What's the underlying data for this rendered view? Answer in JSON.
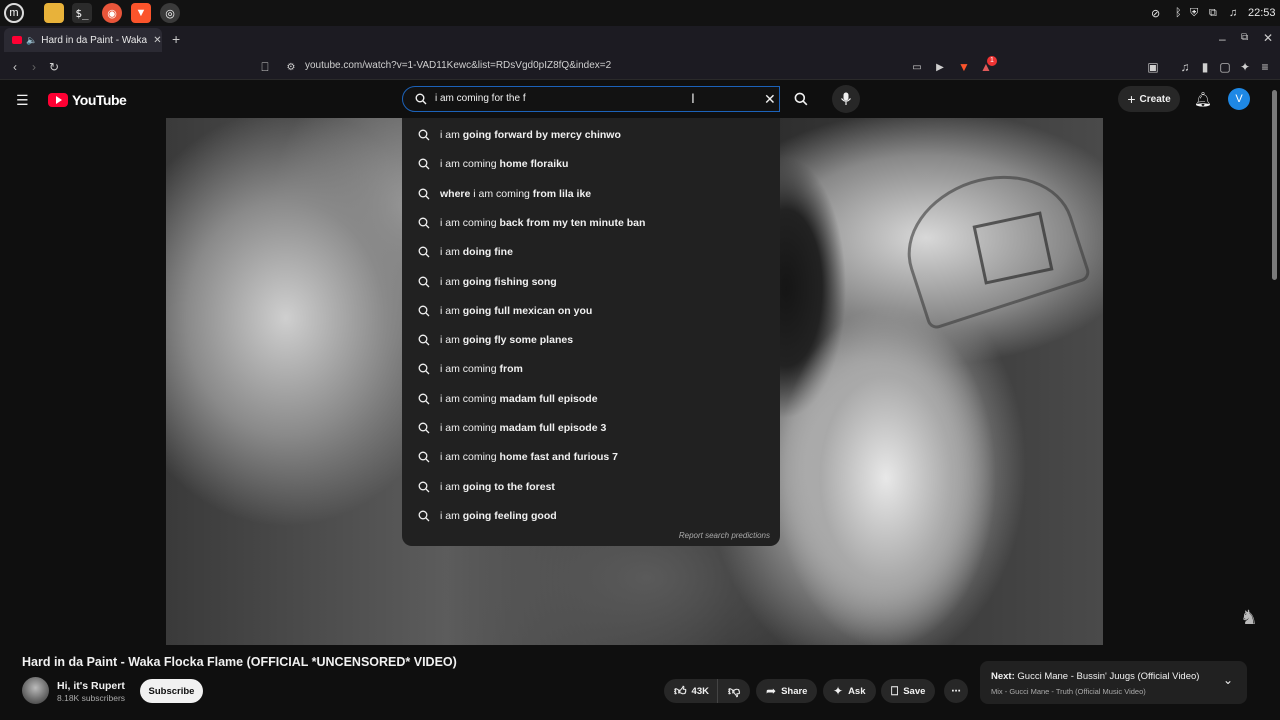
{
  "os": {
    "clock": "22:53",
    "launcher_icons": [
      "mint-menu-icon",
      "files-icon",
      "terminal-icon",
      "firefox-icon",
      "brave-icon",
      "chromium-icon"
    ]
  },
  "browser": {
    "tab_title": "Hard in da Paint - Waka Flo",
    "url": "youtube.com/watch?v=1-VAD11Kewc&list=RDsVgd0pIZ8fQ&index=2",
    "extension_badge": "1"
  },
  "youtube": {
    "logo_text": "YouTube",
    "search": {
      "value": "i am coming for the f",
      "suggestions": [
        {
          "prefix": "i am ",
          "rest": "going forward by mercy chinwo"
        },
        {
          "prefix": "i am coming ",
          "rest": "home floraiku"
        },
        {
          "prefix": "where ",
          "mid": "i am coming ",
          "rest": "from lila ike"
        },
        {
          "prefix": "i am coming ",
          "rest": "back from my ten minute ban"
        },
        {
          "prefix": "i am ",
          "rest": "doing fine"
        },
        {
          "prefix": "i am ",
          "rest": "going fishing song"
        },
        {
          "prefix": "i am ",
          "rest": "going full mexican on you"
        },
        {
          "prefix": "i am ",
          "rest": "going fly some planes"
        },
        {
          "prefix": "i am coming ",
          "rest": "from"
        },
        {
          "prefix": "i am coming ",
          "rest": "madam full episode"
        },
        {
          "prefix": "i am coming ",
          "rest": "madam full episode 3"
        },
        {
          "prefix": "i am coming ",
          "rest": "home fast and furious 7"
        },
        {
          "prefix": "i am ",
          "rest": "going to the forest"
        },
        {
          "prefix": "i am ",
          "rest": "going feeling good"
        }
      ],
      "report_link": "Report search predictions"
    },
    "create_label": "Create",
    "avatar_letter": "V",
    "video": {
      "title": "Hard in da Paint - Waka Flocka Flame (OFFICIAL *UNCENSORED* VIDEO)",
      "channel_name": "Hi, it's Rupert",
      "subscribers": "8.18K subscribers",
      "subscribe_label": "Subscribe",
      "likes": "43K",
      "share_label": "Share",
      "ask_label": "Ask",
      "save_label": "Save"
    },
    "next_up": {
      "label": "Next:",
      "title": "Gucci Mane - Bussin' Juugs (Official Video)",
      "subtitle": "Mix - Gucci Mane - Truth (Official Music Video)"
    }
  },
  "colors": {
    "yt_red": "#ff0033",
    "search_focus": "#1c62b9",
    "dropdown_bg": "#212121",
    "page_bg": "#0f0f0f"
  }
}
